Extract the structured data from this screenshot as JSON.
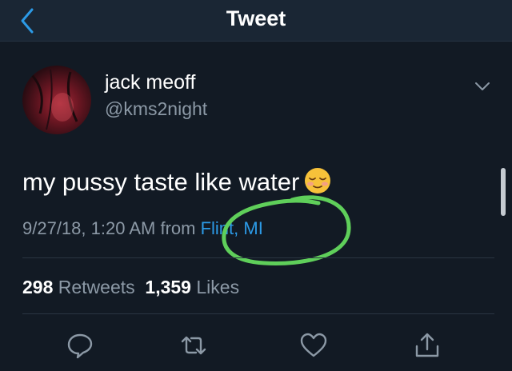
{
  "header": {
    "title": "Tweet"
  },
  "tweet": {
    "author_name": "jack meoff",
    "author_handle": "@kms2night",
    "text": "my pussy taste like water",
    "timestamp": "9/27/18, 1:20 AM",
    "from_label": "from",
    "location": "Flint, MI"
  },
  "stats": {
    "retweets_count": "298",
    "retweets_label": "Retweets",
    "likes_count": "1,359",
    "likes_label": "Likes"
  },
  "icons": {
    "back": "chevron-left-icon",
    "more": "chevron-down-icon",
    "reply": "comment-icon",
    "retweet": "retweet-icon",
    "like": "heart-icon",
    "share": "share-icon",
    "emoji": "relieved-face-emoji"
  },
  "colors": {
    "background": "#121a24",
    "header": "#1a2634",
    "accent": "#2c9ae6",
    "secondary_text": "#8c99a6",
    "annotation": "#5fcf5a"
  }
}
